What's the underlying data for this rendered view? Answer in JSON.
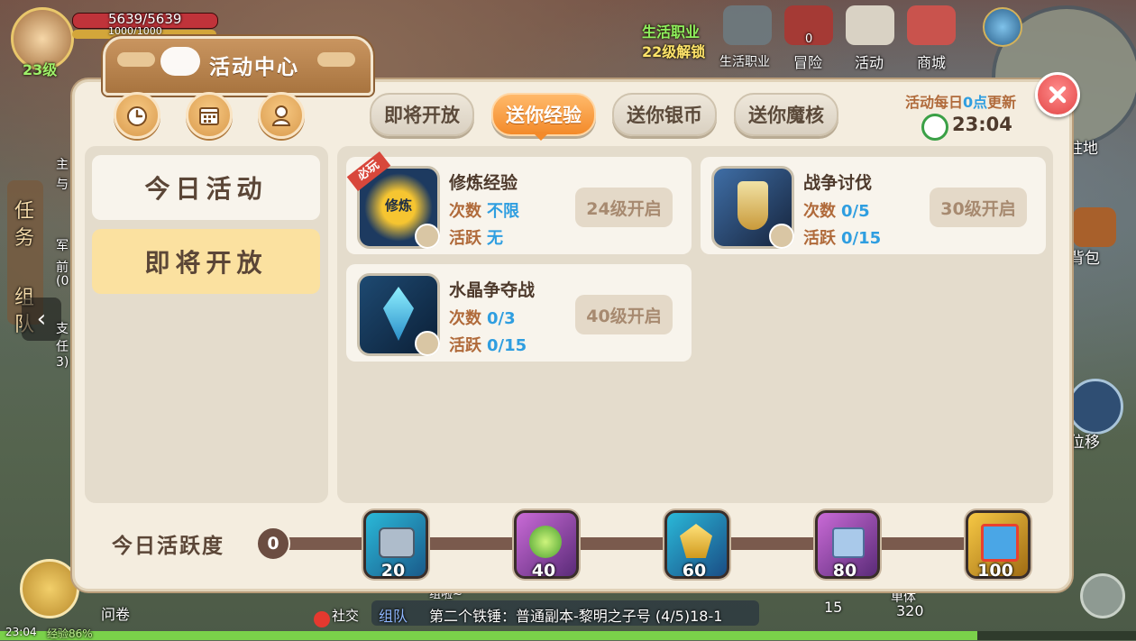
{
  "hud": {
    "hp": "5639/5639",
    "hp_sub": "1000/1000",
    "level": "23级",
    "life_job_title": "生活职业",
    "life_job_unlock": "22级解锁",
    "top_icons": [
      "生活职业",
      "冒险",
      "活动",
      "商城"
    ],
    "adventure_count": "0",
    "right_labels": [
      "驻地",
      "背包",
      "位移"
    ],
    "left_tabs": [
      "任",
      "务",
      "组",
      "队"
    ],
    "left_snippets": [
      "主",
      "与",
      "军",
      "前",
      "(0",
      "支",
      "任",
      "3)"
    ],
    "bottom_scroll": "问卷",
    "bottom_social": "社交",
    "bottom_group": "组队",
    "bottom_quest": "第二个铁锤：普通副本-黎明之子号 (4/5)18-1",
    "bottom_team_label": "组啦~",
    "bottom_time": "23:04",
    "bottom_exp": "经验86%",
    "bottom_single": "单体",
    "bottom_single_num": "320",
    "bottom_num": "15"
  },
  "panel": {
    "title": "活动中心",
    "update_note_prefix": "活动每日",
    "update_note_highlight": "0点",
    "update_note_suffix": "更新",
    "timer": "23:04",
    "tabs": [
      {
        "label": "即将开放",
        "active": false
      },
      {
        "label": "送你经验",
        "active": true
      },
      {
        "label": "送你银币",
        "active": false
      },
      {
        "label": "送你魔核",
        "active": false
      }
    ],
    "left_menu": [
      {
        "label": "今日活动",
        "selected": false
      },
      {
        "label": "即将开放",
        "selected": true
      }
    ],
    "cards": [
      {
        "name": "修炼经验",
        "icon_text": "修炼",
        "times_label": "次数",
        "times_value": "不限",
        "active_label": "活跃",
        "active_value": "无",
        "button": "24级开启",
        "ribbon": "必玩"
      },
      {
        "name": "战争讨伐",
        "times_label": "次数",
        "times_value": "0/5",
        "active_label": "活跃",
        "active_value": "0/15",
        "button": "30级开启"
      },
      {
        "name": "水晶争夺战",
        "times_label": "次数",
        "times_value": "0/3",
        "active_label": "活跃",
        "active_value": "0/15",
        "button": "40级开启"
      }
    ],
    "progress": {
      "label": "今日活跃度",
      "current": "0",
      "milestones": [
        "20",
        "40",
        "60",
        "80",
        "100"
      ]
    }
  },
  "colors": {
    "accent_orange": "#f38a2a",
    "value_blue": "#2f9ee0",
    "close_red": "#e24545"
  }
}
